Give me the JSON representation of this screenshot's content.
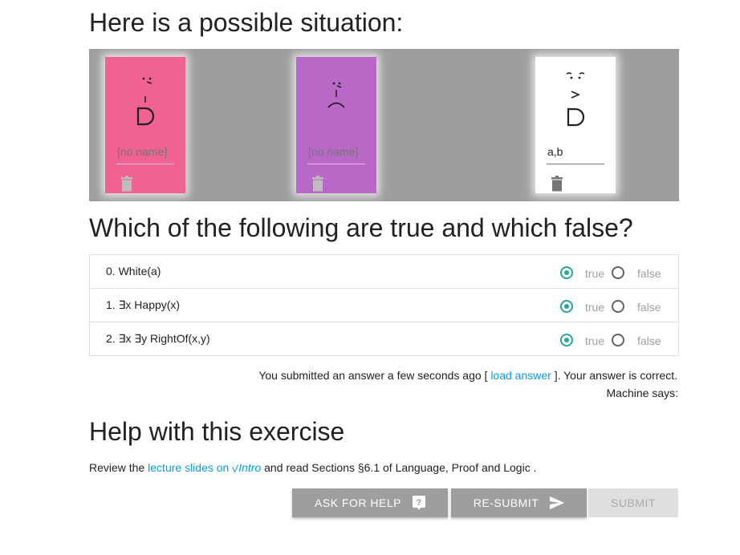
{
  "titles": {
    "situation": "Here is a possible situation:",
    "question": "Which of the following are true and which false?",
    "help": "Help with this exercise"
  },
  "world": {
    "background": "#9e9e9e",
    "cards": [
      {
        "color": "#f06292",
        "face": "happy",
        "name_placeholder": "[no name]",
        "name_value": ""
      },
      {
        "color": "#ba68c8",
        "face": "sad",
        "name_placeholder": "[no name]",
        "name_value": ""
      },
      {
        "color": "#ffffff",
        "face": "angry",
        "name_placeholder": "[no name]",
        "name_value": "a,b"
      }
    ]
  },
  "questions": [
    {
      "label": "0. White(a)",
      "true_label": "true",
      "false_label": "false",
      "selected": "true"
    },
    {
      "label": "1. ∃x Happy(x)",
      "true_label": "true",
      "false_label": "false",
      "selected": "true"
    },
    {
      "label": "2. ∃x ∃y RightOf(x,y)",
      "true_label": "true",
      "false_label": "false",
      "selected": "true"
    }
  ],
  "status": {
    "before": "You submitted an answer a few seconds ago [ ",
    "link": "load answer",
    "after": " ]. Your answer is correct.",
    "machine": "Machine says:"
  },
  "help": {
    "prefix": "Review the ",
    "link1": "lecture slides on ",
    "link1_italic": "Intro",
    "middle": " and read Sections §6.1 of Language, Proof and Logic ."
  },
  "buttons": {
    "ask": "ASK FOR HELP",
    "resubmit": "RE-SUBMIT",
    "submit": "SUBMIT"
  },
  "colors": {
    "accent": "#26a69a",
    "link": "#039be5",
    "button": "#9e9e9e"
  }
}
